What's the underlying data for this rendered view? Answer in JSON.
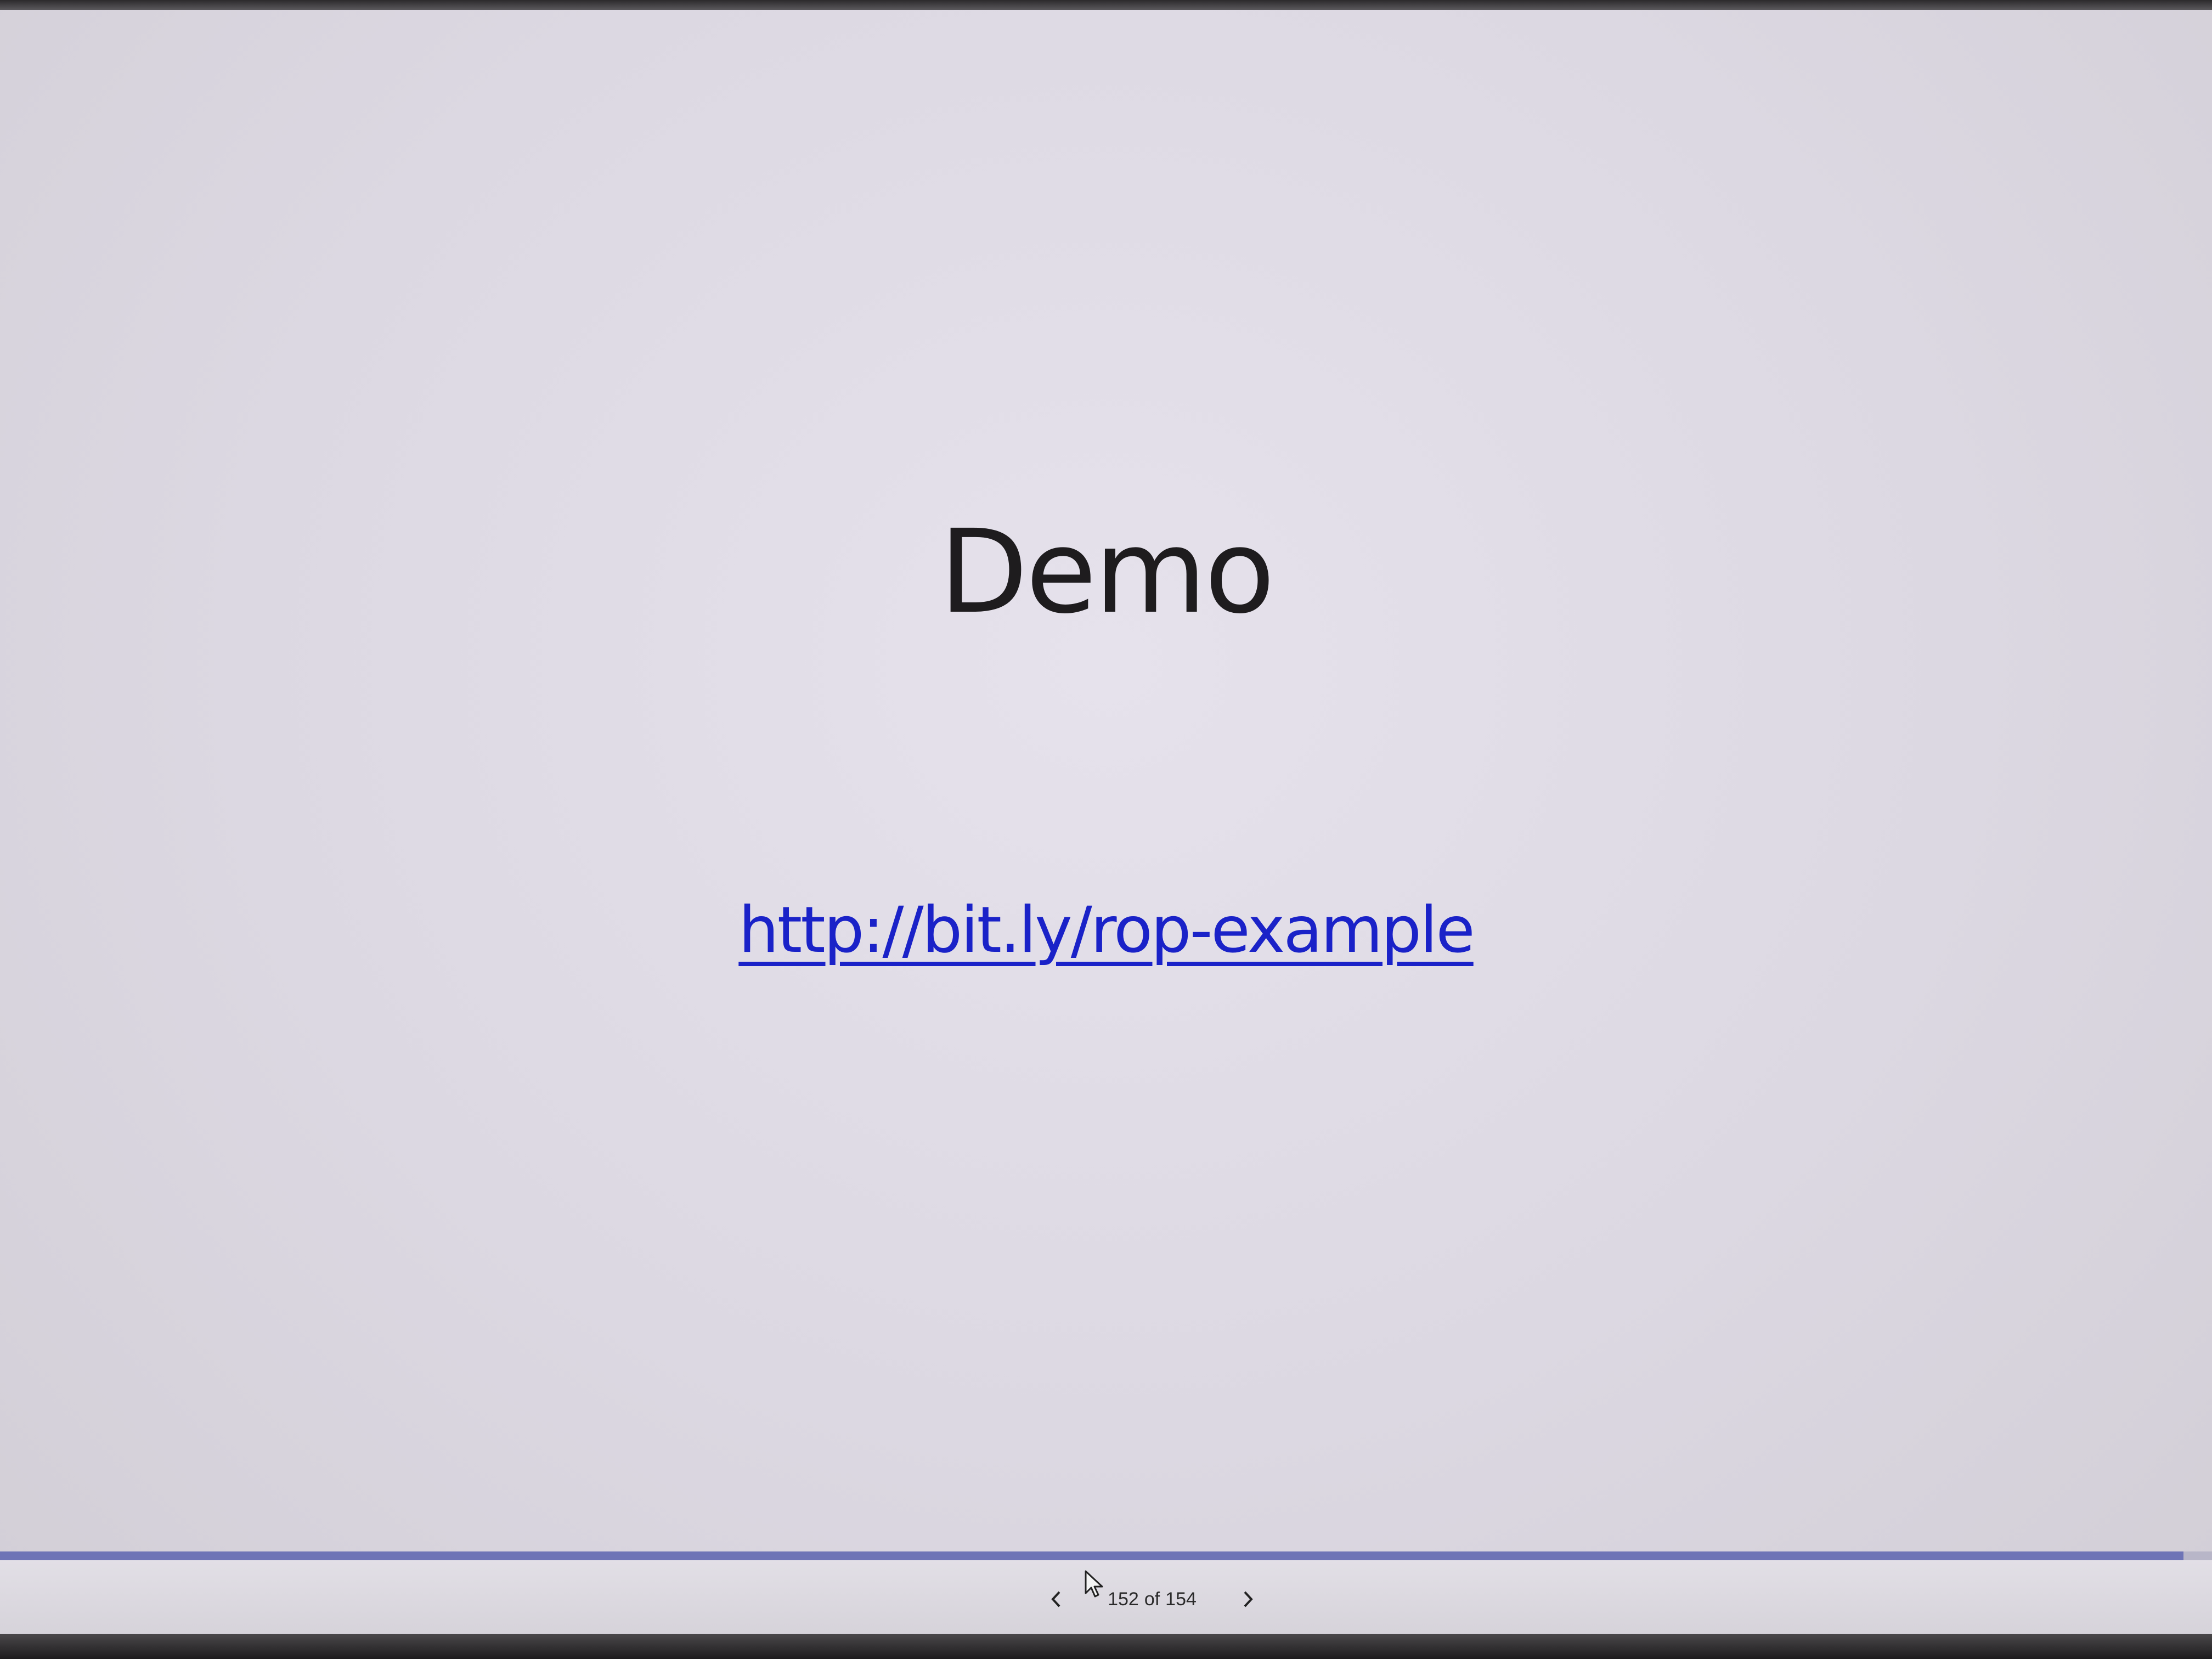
{
  "slide": {
    "title": "Demo",
    "link_text": "http://bit.ly/rop-example"
  },
  "navigation": {
    "current_page": "152",
    "separator": "of",
    "total_pages": "154",
    "progress_fraction": 0.987,
    "prev_icon": "chevron-left-icon",
    "next_icon": "chevron-right-icon"
  },
  "colors": {
    "link": "#1a22c8",
    "progress": "#6e74b6"
  }
}
